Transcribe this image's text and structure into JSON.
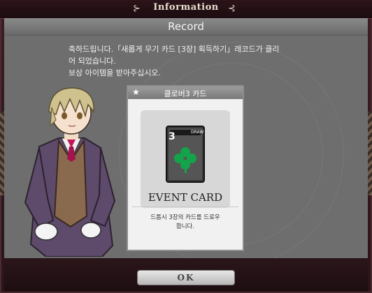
{
  "window": {
    "title": "Information"
  },
  "panel": {
    "heading": "Record"
  },
  "message": {
    "line1": "축하드립니다.「새롭게 무기 카드 [3장] 획득하기」레코드가 클리",
    "line2": "어 되었습니다.",
    "line3": "보상 아이템을 받아주십시오."
  },
  "card": {
    "name": "클로버3 카드",
    "art_number": "3",
    "art_label": "DRAW",
    "title": "EVENT CARD",
    "desc_line1": "드롭시 3장의 카드를 드로우",
    "desc_line2": "합니다."
  },
  "buttons": {
    "ok": "OK"
  },
  "colors": {
    "frame": "#3a1e25",
    "panel": "#6e6e6e",
    "clover": "#14a34a"
  }
}
